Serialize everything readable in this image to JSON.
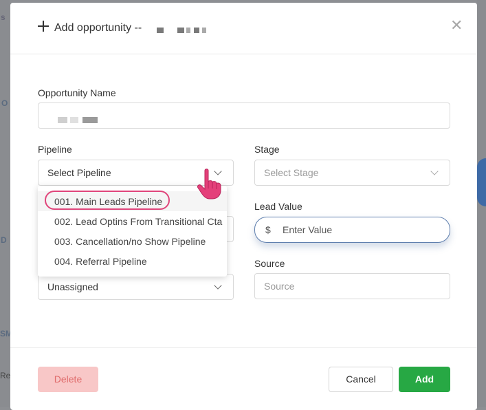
{
  "modal": {
    "title": "Add opportunity --",
    "close_label": "✕"
  },
  "fields": {
    "opportunity_name_label": "Opportunity Name",
    "pipeline_label": "Pipeline",
    "pipeline_value": "Select Pipeline",
    "stage_label": "Stage",
    "stage_placeholder": "Select Stage",
    "lead_value_label": "Lead Value",
    "lead_value_prefix": "$",
    "lead_value_placeholder": "Enter Value",
    "owner_value": "Unassigned",
    "source_label": "Source",
    "source_placeholder": "Source"
  },
  "pipeline_options": [
    "001. Main Leads Pipeline",
    "002. Lead Optins From Transitional Cta",
    "003. Cancellation/no Show Pipeline",
    "004. Referral Pipeline"
  ],
  "buttons": {
    "delete": "Delete",
    "cancel": "Cancel",
    "add": "Add"
  },
  "colors": {
    "add": "#27a844",
    "delete_bg": "#f8c7c7",
    "delete_text": "#e06c6c",
    "highlight_ring": "#e0457b",
    "lead_value_border": "#5f7fae"
  },
  "background": {
    "frag_s": "s",
    "frag_o": "O",
    "frag_d": "D",
    "frag_sm": "SM",
    "frag_re": "Re"
  }
}
